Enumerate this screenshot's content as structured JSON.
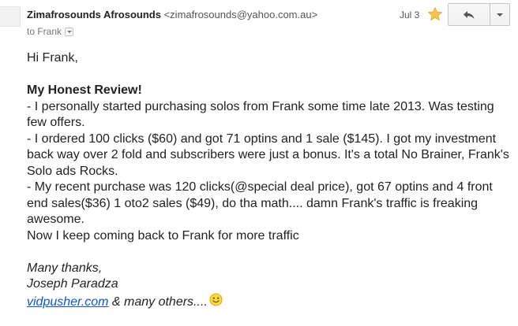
{
  "header": {
    "sender_name": "Zimafrosounds Afrosounds",
    "sender_email": "<zimafrosounds@yahoo.com.au>",
    "to_label": "to Frank",
    "date": "Jul 3",
    "star_icon": "star-icon",
    "reply_icon": "reply-arrow-icon",
    "more_icon": "chevron-down-icon",
    "star_color": "#f7c54a"
  },
  "message": {
    "greeting": "Hi Frank,",
    "review_title": "My Honest Review!",
    "line1": "- I personally started purchasing solos from Frank some time late 2013. Was testing few offers.",
    "line2": "- I ordered 100 clicks ($60) and got 71 optins and 1 sale ($145). I got my investment back way over 2 fold and subscribers were just a bonus. It's a total No Brainer, Frank's Solo ads Rocks.",
    "line3": "- My recent purchase was 120 clicks(@special deal price), got 67 optins and 4 front end sales($36)  1 oto2 sales ($49), do tha math.... damn Frank's traffic is freaking awesome.",
    "line4": "Now I keep coming back to Frank for more traffic",
    "thanks": "Many thanks,",
    "name": "Joseph Paradza",
    "link_text": "vidpusher.com",
    "after_link": " & many others....",
    "smiley_icon": "smiley-icon",
    "link_color": "#1155cc"
  }
}
